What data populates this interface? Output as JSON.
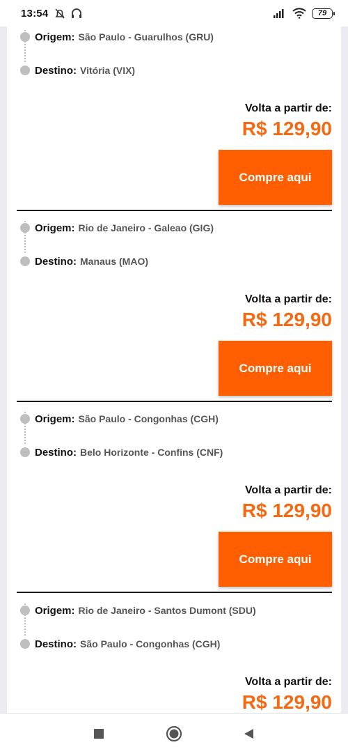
{
  "status_bar": {
    "time": "13:54",
    "battery": "79",
    "icons": [
      "alarm-off-icon",
      "headphones-icon",
      "signal-icon",
      "wifi-icon",
      "battery-icon"
    ]
  },
  "colors": {
    "accent": "#ff5f00",
    "price": "#f46a13",
    "dot": "#bfbfbf"
  },
  "trips": [
    {
      "origin_label": "Origem:",
      "origin": "São Paulo - Guarulhos (GRU)",
      "destination_label": "Destino:",
      "destination": "Vitória (VIX)",
      "price_label": "Volta a partir de:",
      "price": "R$ 129,90",
      "button": "Compre aqui"
    },
    {
      "origin_label": "Origem:",
      "origin": "Rio de Janeiro - Galeao (GIG)",
      "destination_label": "Destino:",
      "destination": "Manaus (MAO)",
      "price_label": "Volta a partir de:",
      "price": "R$ 129,90",
      "button": "Compre aqui"
    },
    {
      "origin_label": "Origem:",
      "origin": "São Paulo - Congonhas (CGH)",
      "destination_label": "Destino:",
      "destination": "Belo Horizonte - Confins (CNF)",
      "price_label": "Volta a partir de:",
      "price": "R$ 129,90",
      "button": "Compre aqui"
    },
    {
      "origin_label": "Origem:",
      "origin": "Rio de Janeiro - Santos Dumont (SDU)",
      "destination_label": "Destino:",
      "destination": "São Paulo - Congonhas (CGH)",
      "price_label": "Volta a partir de:",
      "price": "R$ 129,90"
    }
  ],
  "nav": [
    "recents-square-icon",
    "home-circle-icon",
    "back-triangle-icon"
  ]
}
